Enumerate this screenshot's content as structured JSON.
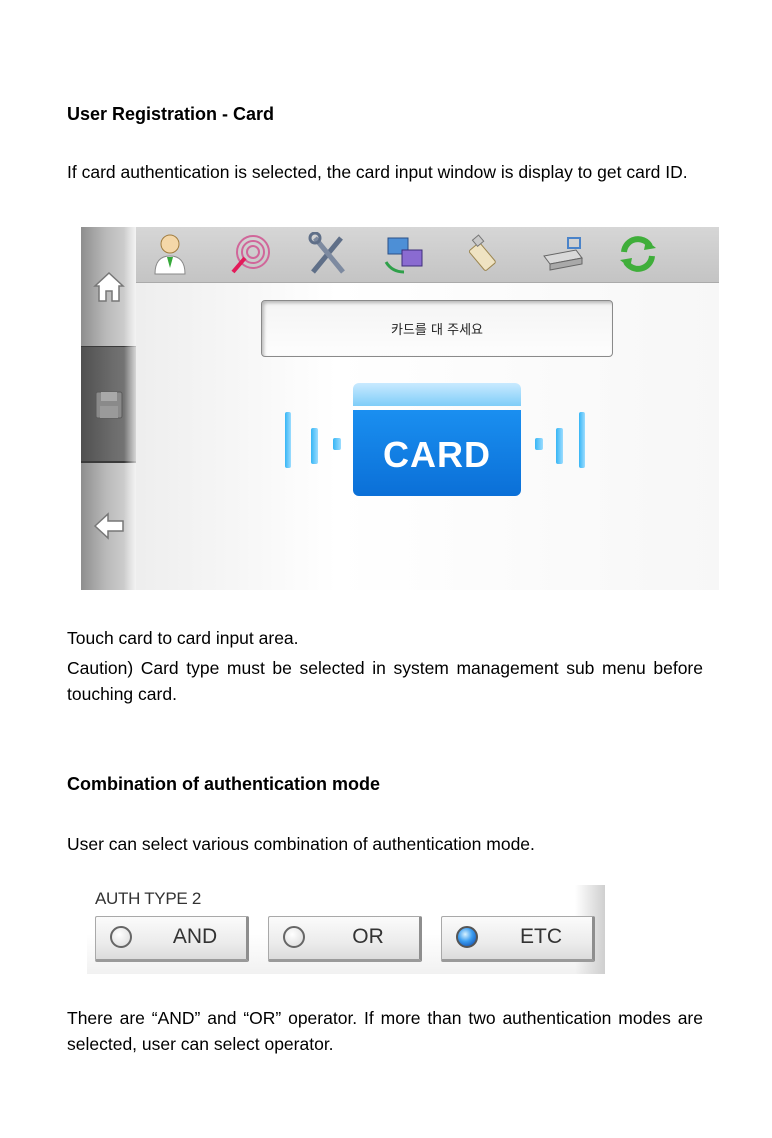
{
  "section1": {
    "heading": "User Registration - Card",
    "intro": "If card authentication is selected, the card input window is display to get card ID."
  },
  "device": {
    "sidebar": [
      {
        "name": "home-icon"
      },
      {
        "name": "save-icon"
      },
      {
        "name": "back-arrow-icon"
      }
    ],
    "toolbar_icons": [
      "user-icon",
      "fingerprint-icon",
      "tools-icon",
      "network-icon",
      "usb-icon",
      "router-icon",
      "refresh-icon"
    ],
    "message": "카드를 대 주세요",
    "card_label": "CARD",
    "colors": {
      "card_blue": "#1a8ff0",
      "wave_blue": "#37b6f5",
      "sidebar_gray": "#b9b9b9"
    }
  },
  "section1_after": {
    "line1": "Touch card to card input area.",
    "caution": "Caution) Card type must be selected in system management sub menu before touching card."
  },
  "section2": {
    "heading": "Combination of authentication mode",
    "intro": "User can select various combination of authentication mode."
  },
  "auth_type": {
    "title": "AUTH TYPE 2",
    "options": [
      {
        "label": "AND",
        "selected": false
      },
      {
        "label": "OR",
        "selected": false
      },
      {
        "label": "ETC",
        "selected": true
      }
    ]
  },
  "section2_after": {
    "text": "There are “AND” and “OR” operator. If more than two authentication modes are selected, user can select operator."
  }
}
